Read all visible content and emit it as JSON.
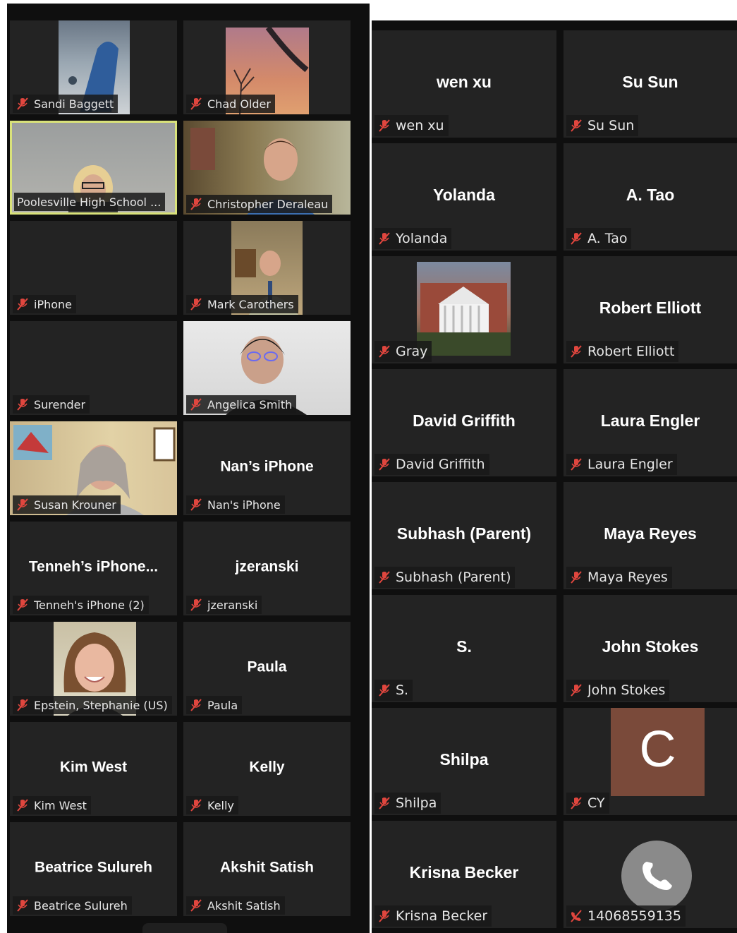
{
  "colors": {
    "panel_bg": "#0f0f0f",
    "tile_bg": "#232323",
    "active_speaker_border": "#d9e27a",
    "muted_icon": "#e0463e",
    "avatar_bg": "#7a4a3a"
  },
  "left_gallery": {
    "tiles": [
      {
        "name": "Sandi Baggett",
        "muted": true,
        "video": true
      },
      {
        "name": "Chad Older",
        "muted": true,
        "video": true
      },
      {
        "name": "Poolesville High School ...",
        "muted": false,
        "video": true,
        "active_speaker": true
      },
      {
        "name": "Christopher Deraleau",
        "muted": true,
        "video": true
      },
      {
        "name": "iPhone",
        "muted": true,
        "video": false
      },
      {
        "name": "Mark Carothers",
        "muted": true,
        "video": true
      },
      {
        "name": "Surender",
        "muted": true,
        "video": false
      },
      {
        "name": "Angelica Smith",
        "muted": true,
        "video": true
      },
      {
        "name": "Susan Krouner",
        "muted": true,
        "video": true
      },
      {
        "name": "Nan's iPhone",
        "display_name": "Nan’s iPhone",
        "muted": true,
        "video": false
      },
      {
        "name": "Tenneh's iPhone (2)",
        "display_name": "Tenneh’s  iPhone...",
        "muted": true,
        "video": false
      },
      {
        "name": "jzeranski",
        "display_name": "jzeranski",
        "muted": true,
        "video": false
      },
      {
        "name": "Epstein, Stephanie (US)",
        "muted": true,
        "video": true
      },
      {
        "name": "Paula",
        "display_name": "Paula",
        "muted": true,
        "video": false
      },
      {
        "name": "Kim West",
        "display_name": "Kim West",
        "muted": true,
        "video": false
      },
      {
        "name": "Kelly",
        "display_name": "Kelly",
        "muted": true,
        "video": false
      },
      {
        "name": "Beatrice Sulureh",
        "display_name": "Beatrice Sulureh",
        "muted": true,
        "video": false
      },
      {
        "name": "Akshit Satish",
        "display_name": "Akshit Satish",
        "muted": true,
        "video": false
      }
    ]
  },
  "right_gallery": {
    "tiles": [
      {
        "name": "wen xu",
        "display_name": "wen xu",
        "muted": true
      },
      {
        "name": "Su Sun",
        "display_name": "Su Sun",
        "muted": true
      },
      {
        "name": "Yolanda",
        "display_name": "Yolanda",
        "muted": true
      },
      {
        "name": "A. Tao",
        "display_name": "A. Tao",
        "muted": true
      },
      {
        "name": "Gray",
        "muted": true,
        "picture": "building-photo"
      },
      {
        "name": "Robert Elliott",
        "display_name": "Robert Elliott",
        "muted": true
      },
      {
        "name": "David Griffith",
        "display_name": "David Griffith",
        "muted": true
      },
      {
        "name": "Laura Engler",
        "display_name": "Laura Engler",
        "muted": true
      },
      {
        "name": "Subhash (Parent)",
        "display_name": "Subhash (Parent)",
        "muted": true
      },
      {
        "name": "Maya Reyes",
        "display_name": "Maya Reyes",
        "muted": true
      },
      {
        "name": "S.",
        "display_name": "S.",
        "muted": true
      },
      {
        "name": "John Stokes",
        "display_name": "John Stokes",
        "muted": true
      },
      {
        "name": "Shilpa",
        "display_name": "Shilpa",
        "muted": true
      },
      {
        "name": "CY",
        "avatar_letter": "C",
        "muted": true
      },
      {
        "name": "Krisna Becker",
        "display_name": "Krisna Becker",
        "muted": true
      },
      {
        "name": "14068559135",
        "muted": true,
        "phone": true
      }
    ]
  }
}
